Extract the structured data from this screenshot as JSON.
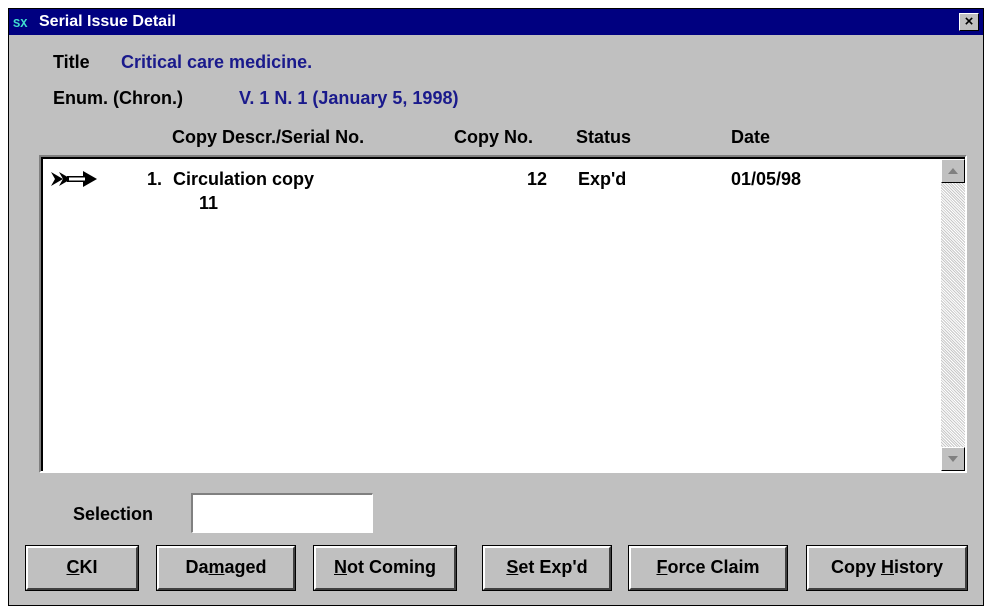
{
  "window": {
    "title": "Serial Issue Detail",
    "close_label": "×"
  },
  "info": {
    "title_label": "Title",
    "title_value": "Critical care medicine.",
    "enum_label": "Enum. (Chron.)",
    "enum_value": "V. 1 N. 1 (January 5, 1998)"
  },
  "columns": {
    "copy_descr": "Copy Descr./Serial No.",
    "copy_no": "Copy No.",
    "status": "Status",
    "date": "Date"
  },
  "rows": [
    {
      "index": "1.",
      "descr": "Circulation copy",
      "serial": "11",
      "copy_no": "12",
      "status": "Exp'd",
      "date": "01/05/98",
      "selected": true
    }
  ],
  "selection": {
    "label": "Selection",
    "value": ""
  },
  "buttons": [
    {
      "pre": "",
      "key": "C",
      "post": "KI"
    },
    {
      "pre": "Da",
      "key": "m",
      "post": "aged"
    },
    {
      "pre": "",
      "key": "N",
      "post": "ot Coming"
    },
    {
      "pre": "",
      "key": "S",
      "post": "et Exp'd"
    },
    {
      "pre": "",
      "key": "F",
      "post": "orce Claim"
    },
    {
      "pre": "Copy ",
      "key": "H",
      "post": "istory"
    }
  ],
  "icons": {
    "app": "app-icon",
    "row_pointer": "pointer-arrow-icon",
    "scroll_up": "scroll-up-arrow-icon",
    "scroll_down": "scroll-down-arrow-icon"
  }
}
